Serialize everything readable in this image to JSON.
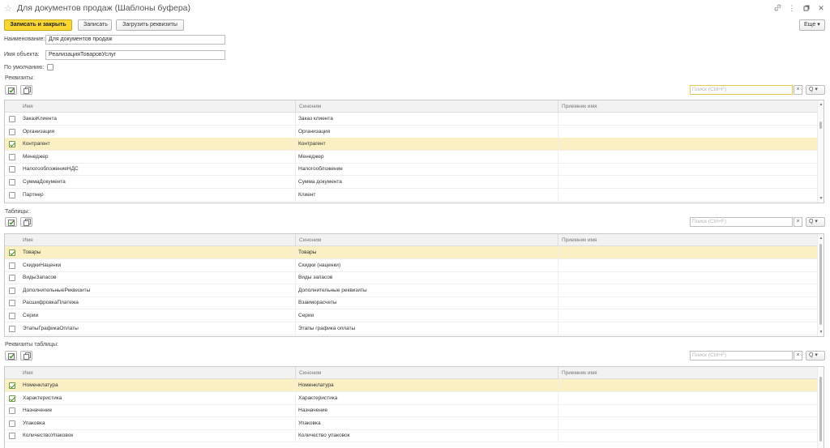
{
  "window": {
    "title": "Для документов продаж (Шаблоны буфера)",
    "icons": [
      "link-icon",
      "more-vert-icon",
      "maximize-icon",
      "close-icon"
    ]
  },
  "toolbar": {
    "save_close": "Записать и закрыть",
    "save": "Записать",
    "load": "Загрузить реквизиты",
    "more": "Еще"
  },
  "form": {
    "name_label": "Наименование:",
    "name_value": "Для документов продаж",
    "object_label": "Имя объекта:",
    "object_value": "РеализацияТоваровУслуг",
    "default_label": "По умолчанию:"
  },
  "sections": {
    "props_label": "Реквизиты:",
    "tables_label": "Таблицы:",
    "table_props_label": "Реквизиты таблицы:",
    "search_placeholder": "Поиск (Ctrl+F)",
    "search_clear": "×",
    "search_go": "Q ▾"
  },
  "columns": {
    "name": "Имя",
    "synonym": "Синоним",
    "receiver": "Приемник имя"
  },
  "props_rows": [
    {
      "name": "ЗаказКлиента",
      "synonym": "Заказ клиента",
      "checked": false,
      "selected": false
    },
    {
      "name": "Организация",
      "synonym": "Организация",
      "checked": false,
      "selected": false
    },
    {
      "name": "Контрагент",
      "synonym": "Контрагент",
      "checked": true,
      "selected": true
    },
    {
      "name": "Менеджер",
      "synonym": "Менеджер",
      "checked": false,
      "selected": false
    },
    {
      "name": "НалогообложениеНДС",
      "synonym": "Налогообложение",
      "checked": false,
      "selected": false
    },
    {
      "name": "СуммаДокумента",
      "synonym": "Сумма документа",
      "checked": false,
      "selected": false
    },
    {
      "name": "Партнер",
      "synonym": "Клиент",
      "checked": false,
      "selected": false
    }
  ],
  "tables_rows": [
    {
      "name": "Товары",
      "synonym": "Товары",
      "checked": true,
      "selected": true
    },
    {
      "name": "СкидкиНаценки",
      "synonym": "Скидки (наценки)",
      "checked": false,
      "selected": false
    },
    {
      "name": "ВидыЗапасов",
      "synonym": "Виды запасов",
      "checked": false,
      "selected": false
    },
    {
      "name": "ДополнительныеРеквизиты",
      "synonym": "Дополнительные реквизиты",
      "checked": false,
      "selected": false
    },
    {
      "name": "РасшифровкаПлатежа",
      "synonym": "Взаиморасчеты",
      "checked": false,
      "selected": false
    },
    {
      "name": "Серии",
      "synonym": "Серии",
      "checked": false,
      "selected": false
    },
    {
      "name": "ЭтапыГрафикаОплаты",
      "synonym": "Этапы графика оплаты",
      "checked": false,
      "selected": false
    }
  ],
  "table_props_rows": [
    {
      "name": "Номенклатура",
      "synonym": "Номенклатура",
      "checked": true,
      "selected": true
    },
    {
      "name": "Характеристика",
      "synonym": "Характеристика",
      "checked": true,
      "selected": false
    },
    {
      "name": "Назначение",
      "synonym": "Назначение",
      "checked": false,
      "selected": false
    },
    {
      "name": "Упаковка",
      "synonym": "Упаковка",
      "checked": false,
      "selected": false
    },
    {
      "name": "КоличествоУпаковок",
      "synonym": "Количество упаковок",
      "checked": false,
      "selected": false
    }
  ]
}
